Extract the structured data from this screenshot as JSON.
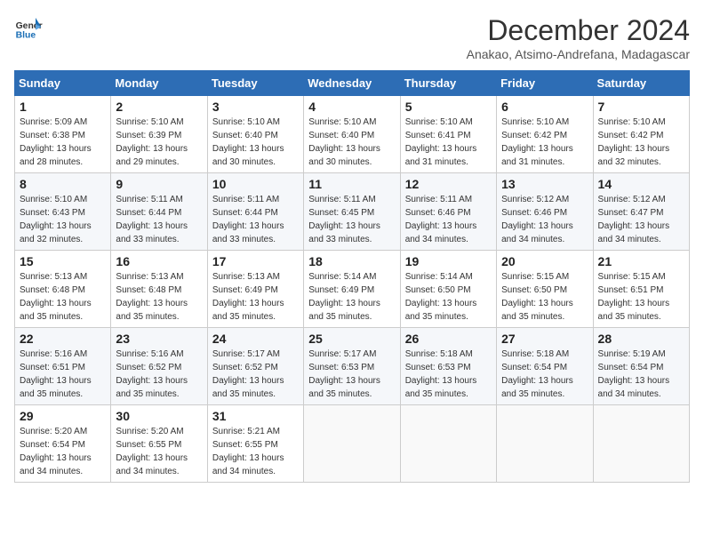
{
  "logo": {
    "line1": "General",
    "line2": "Blue"
  },
  "title": "December 2024",
  "subtitle": "Anakao, Atsimo-Andrefana, Madagascar",
  "days_of_week": [
    "Sunday",
    "Monday",
    "Tuesday",
    "Wednesday",
    "Thursday",
    "Friday",
    "Saturday"
  ],
  "weeks": [
    [
      {
        "day": "1",
        "sunrise": "5:09 AM",
        "sunset": "6:38 PM",
        "daylight": "13 hours and 28 minutes."
      },
      {
        "day": "2",
        "sunrise": "5:10 AM",
        "sunset": "6:39 PM",
        "daylight": "13 hours and 29 minutes."
      },
      {
        "day": "3",
        "sunrise": "5:10 AM",
        "sunset": "6:40 PM",
        "daylight": "13 hours and 30 minutes."
      },
      {
        "day": "4",
        "sunrise": "5:10 AM",
        "sunset": "6:40 PM",
        "daylight": "13 hours and 30 minutes."
      },
      {
        "day": "5",
        "sunrise": "5:10 AM",
        "sunset": "6:41 PM",
        "daylight": "13 hours and 31 minutes."
      },
      {
        "day": "6",
        "sunrise": "5:10 AM",
        "sunset": "6:42 PM",
        "daylight": "13 hours and 31 minutes."
      },
      {
        "day": "7",
        "sunrise": "5:10 AM",
        "sunset": "6:42 PM",
        "daylight": "13 hours and 32 minutes."
      }
    ],
    [
      {
        "day": "8",
        "sunrise": "5:10 AM",
        "sunset": "6:43 PM",
        "daylight": "13 hours and 32 minutes."
      },
      {
        "day": "9",
        "sunrise": "5:11 AM",
        "sunset": "6:44 PM",
        "daylight": "13 hours and 33 minutes."
      },
      {
        "day": "10",
        "sunrise": "5:11 AM",
        "sunset": "6:44 PM",
        "daylight": "13 hours and 33 minutes."
      },
      {
        "day": "11",
        "sunrise": "5:11 AM",
        "sunset": "6:45 PM",
        "daylight": "13 hours and 33 minutes."
      },
      {
        "day": "12",
        "sunrise": "5:11 AM",
        "sunset": "6:46 PM",
        "daylight": "13 hours and 34 minutes."
      },
      {
        "day": "13",
        "sunrise": "5:12 AM",
        "sunset": "6:46 PM",
        "daylight": "13 hours and 34 minutes."
      },
      {
        "day": "14",
        "sunrise": "5:12 AM",
        "sunset": "6:47 PM",
        "daylight": "13 hours and 34 minutes."
      }
    ],
    [
      {
        "day": "15",
        "sunrise": "5:13 AM",
        "sunset": "6:48 PM",
        "daylight": "13 hours and 35 minutes."
      },
      {
        "day": "16",
        "sunrise": "5:13 AM",
        "sunset": "6:48 PM",
        "daylight": "13 hours and 35 minutes."
      },
      {
        "day": "17",
        "sunrise": "5:13 AM",
        "sunset": "6:49 PM",
        "daylight": "13 hours and 35 minutes."
      },
      {
        "day": "18",
        "sunrise": "5:14 AM",
        "sunset": "6:49 PM",
        "daylight": "13 hours and 35 minutes."
      },
      {
        "day": "19",
        "sunrise": "5:14 AM",
        "sunset": "6:50 PM",
        "daylight": "13 hours and 35 minutes."
      },
      {
        "day": "20",
        "sunrise": "5:15 AM",
        "sunset": "6:50 PM",
        "daylight": "13 hours and 35 minutes."
      },
      {
        "day": "21",
        "sunrise": "5:15 AM",
        "sunset": "6:51 PM",
        "daylight": "13 hours and 35 minutes."
      }
    ],
    [
      {
        "day": "22",
        "sunrise": "5:16 AM",
        "sunset": "6:51 PM",
        "daylight": "13 hours and 35 minutes."
      },
      {
        "day": "23",
        "sunrise": "5:16 AM",
        "sunset": "6:52 PM",
        "daylight": "13 hours and 35 minutes."
      },
      {
        "day": "24",
        "sunrise": "5:17 AM",
        "sunset": "6:52 PM",
        "daylight": "13 hours and 35 minutes."
      },
      {
        "day": "25",
        "sunrise": "5:17 AM",
        "sunset": "6:53 PM",
        "daylight": "13 hours and 35 minutes."
      },
      {
        "day": "26",
        "sunrise": "5:18 AM",
        "sunset": "6:53 PM",
        "daylight": "13 hours and 35 minutes."
      },
      {
        "day": "27",
        "sunrise": "5:18 AM",
        "sunset": "6:54 PM",
        "daylight": "13 hours and 35 minutes."
      },
      {
        "day": "28",
        "sunrise": "5:19 AM",
        "sunset": "6:54 PM",
        "daylight": "13 hours and 34 minutes."
      }
    ],
    [
      {
        "day": "29",
        "sunrise": "5:20 AM",
        "sunset": "6:54 PM",
        "daylight": "13 hours and 34 minutes."
      },
      {
        "day": "30",
        "sunrise": "5:20 AM",
        "sunset": "6:55 PM",
        "daylight": "13 hours and 34 minutes."
      },
      {
        "day": "31",
        "sunrise": "5:21 AM",
        "sunset": "6:55 PM",
        "daylight": "13 hours and 34 minutes."
      },
      null,
      null,
      null,
      null
    ]
  ]
}
